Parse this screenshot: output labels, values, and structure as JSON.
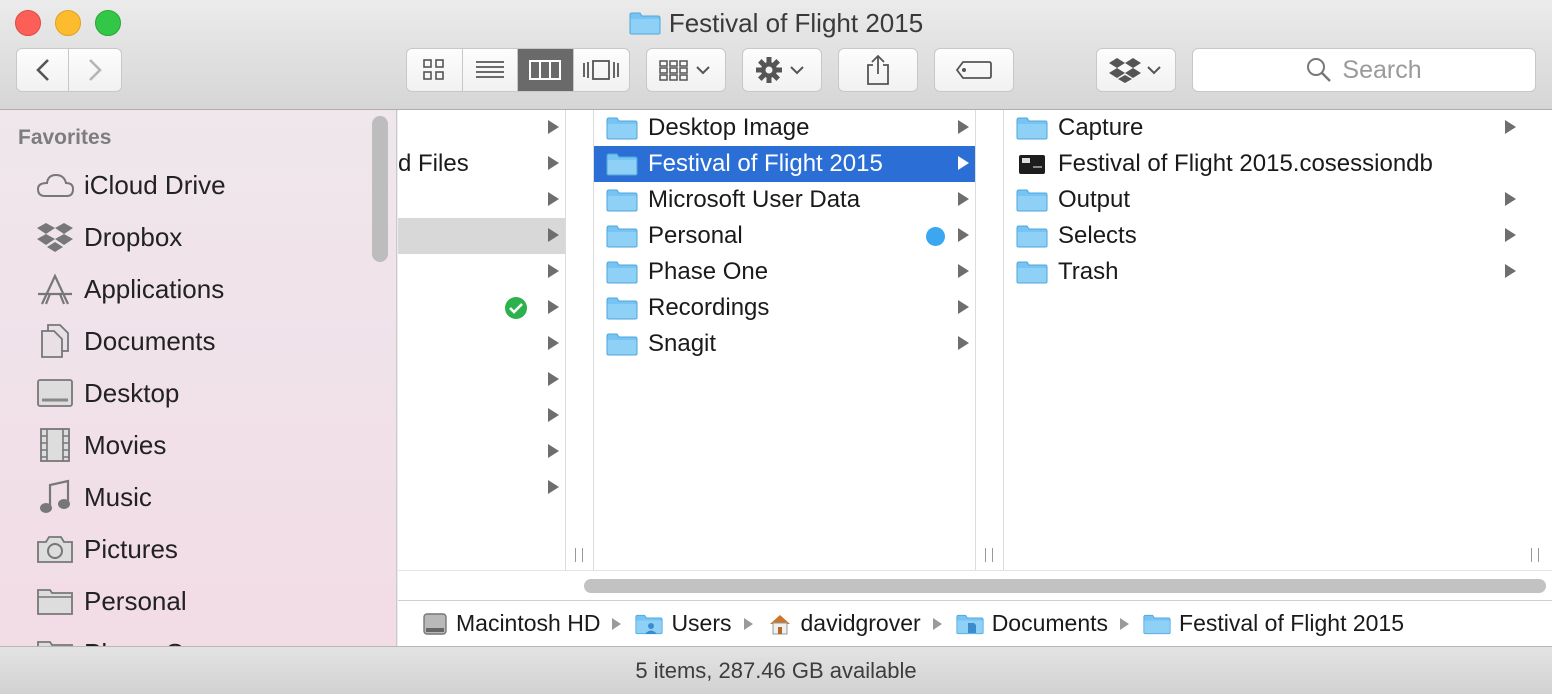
{
  "window": {
    "title": "Festival of Flight 2015"
  },
  "toolbar": {
    "back_icon": "chevron-left-icon",
    "forward_icon": "chevron-right-icon",
    "view_modes": [
      "icon-view-icon",
      "list-view-icon",
      "column-view-icon",
      "coverflow-view-icon"
    ],
    "active_view": "column",
    "search_placeholder": "Search"
  },
  "sidebar": {
    "heading": "Favorites",
    "items": [
      {
        "label": "iCloud Drive",
        "icon": "cloud-icon"
      },
      {
        "label": "Dropbox",
        "icon": "dropbox-icon"
      },
      {
        "label": "Applications",
        "icon": "applications-icon"
      },
      {
        "label": "Documents",
        "icon": "documents-icon"
      },
      {
        "label": "Desktop",
        "icon": "desktop-icon"
      },
      {
        "label": "Movies",
        "icon": "film-icon"
      },
      {
        "label": "Music",
        "icon": "music-note-icon"
      },
      {
        "label": "Pictures",
        "icon": "camera-icon"
      },
      {
        "label": "Personal",
        "icon": "folder-icon"
      },
      {
        "label": "Phase One",
        "icon": "folder-icon"
      }
    ]
  },
  "columns": {
    "col1": {
      "rows": [
        {
          "label": ""
        },
        {
          "label": "d Files"
        },
        {
          "label": ""
        },
        {
          "label": "",
          "selected_inactive": true
        },
        {
          "label": ""
        },
        {
          "label": "",
          "badge": "green-check"
        },
        {
          "label": ""
        },
        {
          "label": ""
        },
        {
          "label": ""
        },
        {
          "label": ""
        },
        {
          "label": ""
        }
      ]
    },
    "col2": {
      "rows": [
        {
          "label": "Desktop Image"
        },
        {
          "label": "Festival of Flight 2015",
          "selected": true
        },
        {
          "label": "Microsoft User Data"
        },
        {
          "label": "Personal",
          "tag": "blue"
        },
        {
          "label": "Phase One"
        },
        {
          "label": "Recordings"
        },
        {
          "label": "Snagit"
        }
      ]
    },
    "col3": {
      "rows": [
        {
          "label": "Capture",
          "kind": "folder"
        },
        {
          "label": "Festival of Flight 2015.cosessiondb",
          "kind": "file"
        },
        {
          "label": "Output",
          "kind": "folder"
        },
        {
          "label": "Selects",
          "kind": "folder"
        },
        {
          "label": "Trash",
          "kind": "folder"
        }
      ]
    }
  },
  "pathbar": {
    "crumbs": [
      "Macintosh HD",
      "Users",
      "davidgrover",
      "Documents",
      "Festival of Flight 2015"
    ]
  },
  "status": {
    "text": "5 items, 287.46 GB available"
  },
  "colors": {
    "selection": "#2b6fd6",
    "folder": "#6fc3f5",
    "tag_blue": "#3aa7f0",
    "check_green": "#2bb24c"
  }
}
